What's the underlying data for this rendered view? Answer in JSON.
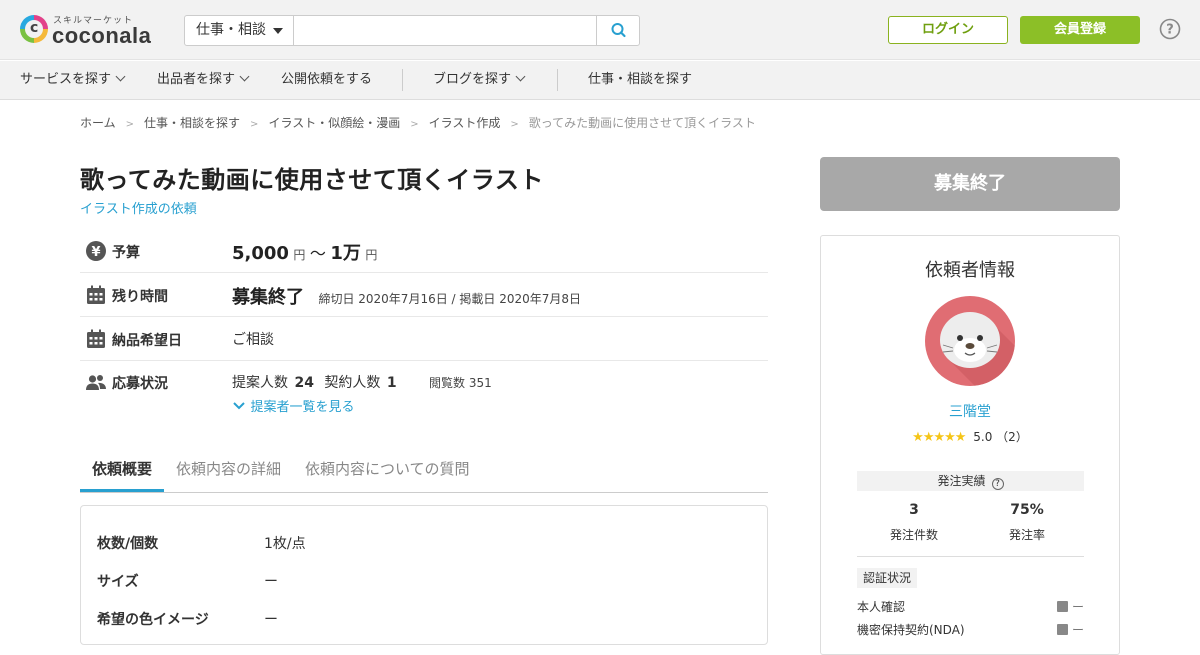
{
  "header": {
    "logo_kana": "スキルマーケット",
    "logo_text": "coconala",
    "search_category": "仕事・相談",
    "search_placeholder": "",
    "login_label": "ログイン",
    "register_label": "会員登録"
  },
  "nav": {
    "items": [
      "サービスを探す",
      "出品者を探す",
      "公開依頼をする",
      "ブログを探す",
      "仕事・相談を探す"
    ]
  },
  "breadcrumb": [
    "ホーム",
    "仕事・相談を探す",
    "イラスト・似顔絵・漫画",
    "イラスト作成",
    "歌ってみた動画に使用させて頂くイラスト"
  ],
  "request": {
    "title": "歌ってみた動画に使用させて頂くイラスト",
    "category_link": "イラスト作成の依頼",
    "budget_label": "予算",
    "budget_min": "5,000",
    "budget_unit": "円",
    "budget_sep": "〜",
    "budget_max": "1万",
    "remaining_label": "残り時間",
    "remaining_value": "募集終了",
    "deadline_text": "締切日 2020年7月16日 / 掲載日 2020年7月8日",
    "delivery_label": "納品希望日",
    "delivery_value": "ご相談",
    "status_label": "応募状況",
    "proposals_label": "提案人数",
    "proposals_value": "24",
    "contracts_label": "契約人数",
    "contracts_value": "1",
    "views_text": "閲覧数 351",
    "proposers_link": "提案者一覧を見る"
  },
  "tabs": [
    "依頼概要",
    "依頼内容の詳細",
    "依頼内容についての質問"
  ],
  "details": [
    {
      "label": "枚数/個数",
      "value": "1枚/点"
    },
    {
      "label": "サイズ",
      "value": "ー"
    },
    {
      "label": "希望の色イメージ",
      "value": "ー"
    }
  ],
  "sidebar": {
    "closed_button": "募集終了",
    "client_heading": "依頼者情報",
    "username": "三階堂",
    "stars": "★★★★★",
    "rating_text": "5.0 （2）",
    "orders_heading": "発注実績",
    "order_count_value": "3",
    "order_count_label": "発注件数",
    "order_rate_value": "75%",
    "order_rate_label": "発注率",
    "verification_heading": "認証状況",
    "verifications": [
      {
        "label": "本人確認",
        "value": "ー"
      },
      {
        "label": "機密保持契約(NDA)",
        "value": "ー"
      }
    ]
  },
  "colors": {
    "accent_blue": "#28a0d0",
    "brand_green": "#8cbf27",
    "closed_gray": "#a8a8a8",
    "avatar_bg": "#e06d73"
  }
}
